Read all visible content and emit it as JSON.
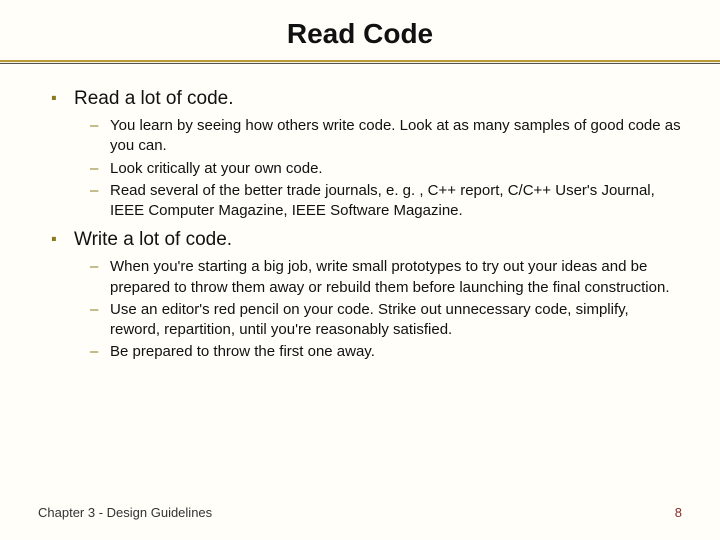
{
  "title": "Read Code",
  "bullets": [
    {
      "heading": "Read a lot of code.",
      "subs": [
        "You learn by seeing how others write code.  Look at as many samples of good code as you can.",
        "Look critically at your own code.",
        "Read several of the better trade journals, e. g. , C++ report, C/C++ User's Journal, IEEE Computer Magazine, IEEE Software Magazine."
      ]
    },
    {
      "heading": "Write a lot of code.",
      "subs": [
        "When you're starting a big job, write small prototypes to try out your ideas and be prepared to throw them away or rebuild them before launching the final construction.",
        "Use an editor's red pencil on your code.  Strike out unnecessary code, simplify, reword, repartition, until you're reasonably satisfied.",
        "Be prepared to throw the first one away."
      ]
    }
  ],
  "footer_left": "Chapter 3 - Design Guidelines",
  "footer_right": "8"
}
